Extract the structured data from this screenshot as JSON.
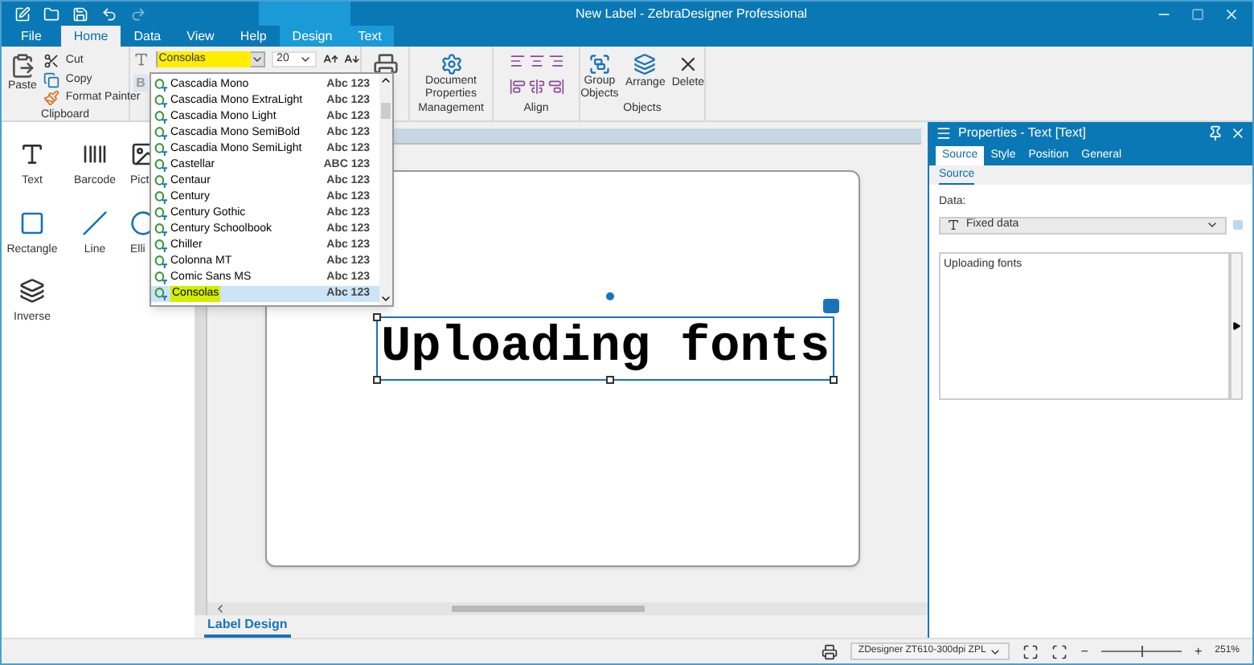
{
  "window": {
    "title": "New Label - ZebraDesigner Professional"
  },
  "ribbon_tabs": [
    {
      "label": "File",
      "selected": false,
      "kind": "file"
    },
    {
      "label": "Home",
      "selected": true,
      "kind": "normal"
    },
    {
      "label": "Data",
      "selected": false,
      "kind": "normal"
    },
    {
      "label": "View",
      "selected": false,
      "kind": "normal"
    },
    {
      "label": "Help",
      "selected": false,
      "kind": "normal"
    },
    {
      "label": "Design",
      "selected": false,
      "kind": "context"
    },
    {
      "label": "Text",
      "selected": false,
      "kind": "context"
    }
  ],
  "clipboard": {
    "paste": "Paste",
    "cut": "Cut",
    "copy": "Copy",
    "format_painter": "Format Painter",
    "label": "Clipboard"
  },
  "font": {
    "name": "Consolas",
    "size": "20",
    "bold": "B"
  },
  "management": {
    "button": "Document Properties",
    "label": "Management"
  },
  "align": {
    "label": "Align"
  },
  "objects": {
    "group": "Group Objects",
    "arrange": "Arrange",
    "delete": "Delete",
    "label": "Objects"
  },
  "font_list": [
    {
      "name": "Cascadia Mono",
      "sample": "Abc 123",
      "selected": false
    },
    {
      "name": "Cascadia Mono ExtraLight",
      "sample": "Abc 123",
      "selected": false
    },
    {
      "name": "Cascadia Mono Light",
      "sample": "Abc 123",
      "selected": false
    },
    {
      "name": "Cascadia Mono SemiBold",
      "sample": "Abc 123",
      "selected": false
    },
    {
      "name": "Cascadia Mono SemiLight",
      "sample": "Abc 123",
      "selected": false
    },
    {
      "name": "Castellar",
      "sample": "ABC 123",
      "selected": false
    },
    {
      "name": "Centaur",
      "sample": "Abc 123",
      "selected": false
    },
    {
      "name": "Century",
      "sample": "Abc 123",
      "selected": false
    },
    {
      "name": "Century Gothic",
      "sample": "Abc 123",
      "selected": false
    },
    {
      "name": "Century Schoolbook",
      "sample": "Abc 123",
      "selected": false
    },
    {
      "name": "Chiller",
      "sample": "Abc 123",
      "selected": false
    },
    {
      "name": "Colonna MT",
      "sample": "Abc 123",
      "selected": false
    },
    {
      "name": "Comic Sans MS",
      "sample": "Abc 123",
      "selected": false
    },
    {
      "name": "Consolas",
      "sample": "Abc 123",
      "selected": true
    }
  ],
  "toolbox": [
    {
      "label": "Text",
      "kind": "text"
    },
    {
      "label": "Barcode",
      "kind": "barcode"
    },
    {
      "label": "Pict",
      "kind": "picture"
    },
    {
      "label": "Rectangle",
      "kind": "rectangle"
    },
    {
      "label": "Line",
      "kind": "line"
    },
    {
      "label": "Elli",
      "kind": "ellipse"
    },
    {
      "label": "Inverse",
      "kind": "inverse"
    }
  ],
  "label_text": "Uploading fonts",
  "document_tab": "Label Design",
  "properties": {
    "title": "Properties - Text [Text]",
    "tabs": [
      {
        "label": "Source",
        "selected": true
      },
      {
        "label": "Style",
        "selected": false
      },
      {
        "label": "Position",
        "selected": false
      },
      {
        "label": "General",
        "selected": false
      }
    ],
    "subtab": "Source",
    "data_label": "Data:",
    "data_value": "Fixed data",
    "content": "Uploading fonts"
  },
  "status_bar": {
    "printer": "ZDesigner ZT610-300dpi ZPL",
    "zoom_out": "−",
    "zoom_in": "+",
    "zoom": "251%",
    "zoom_slider": {
      "level": 0.5
    }
  }
}
